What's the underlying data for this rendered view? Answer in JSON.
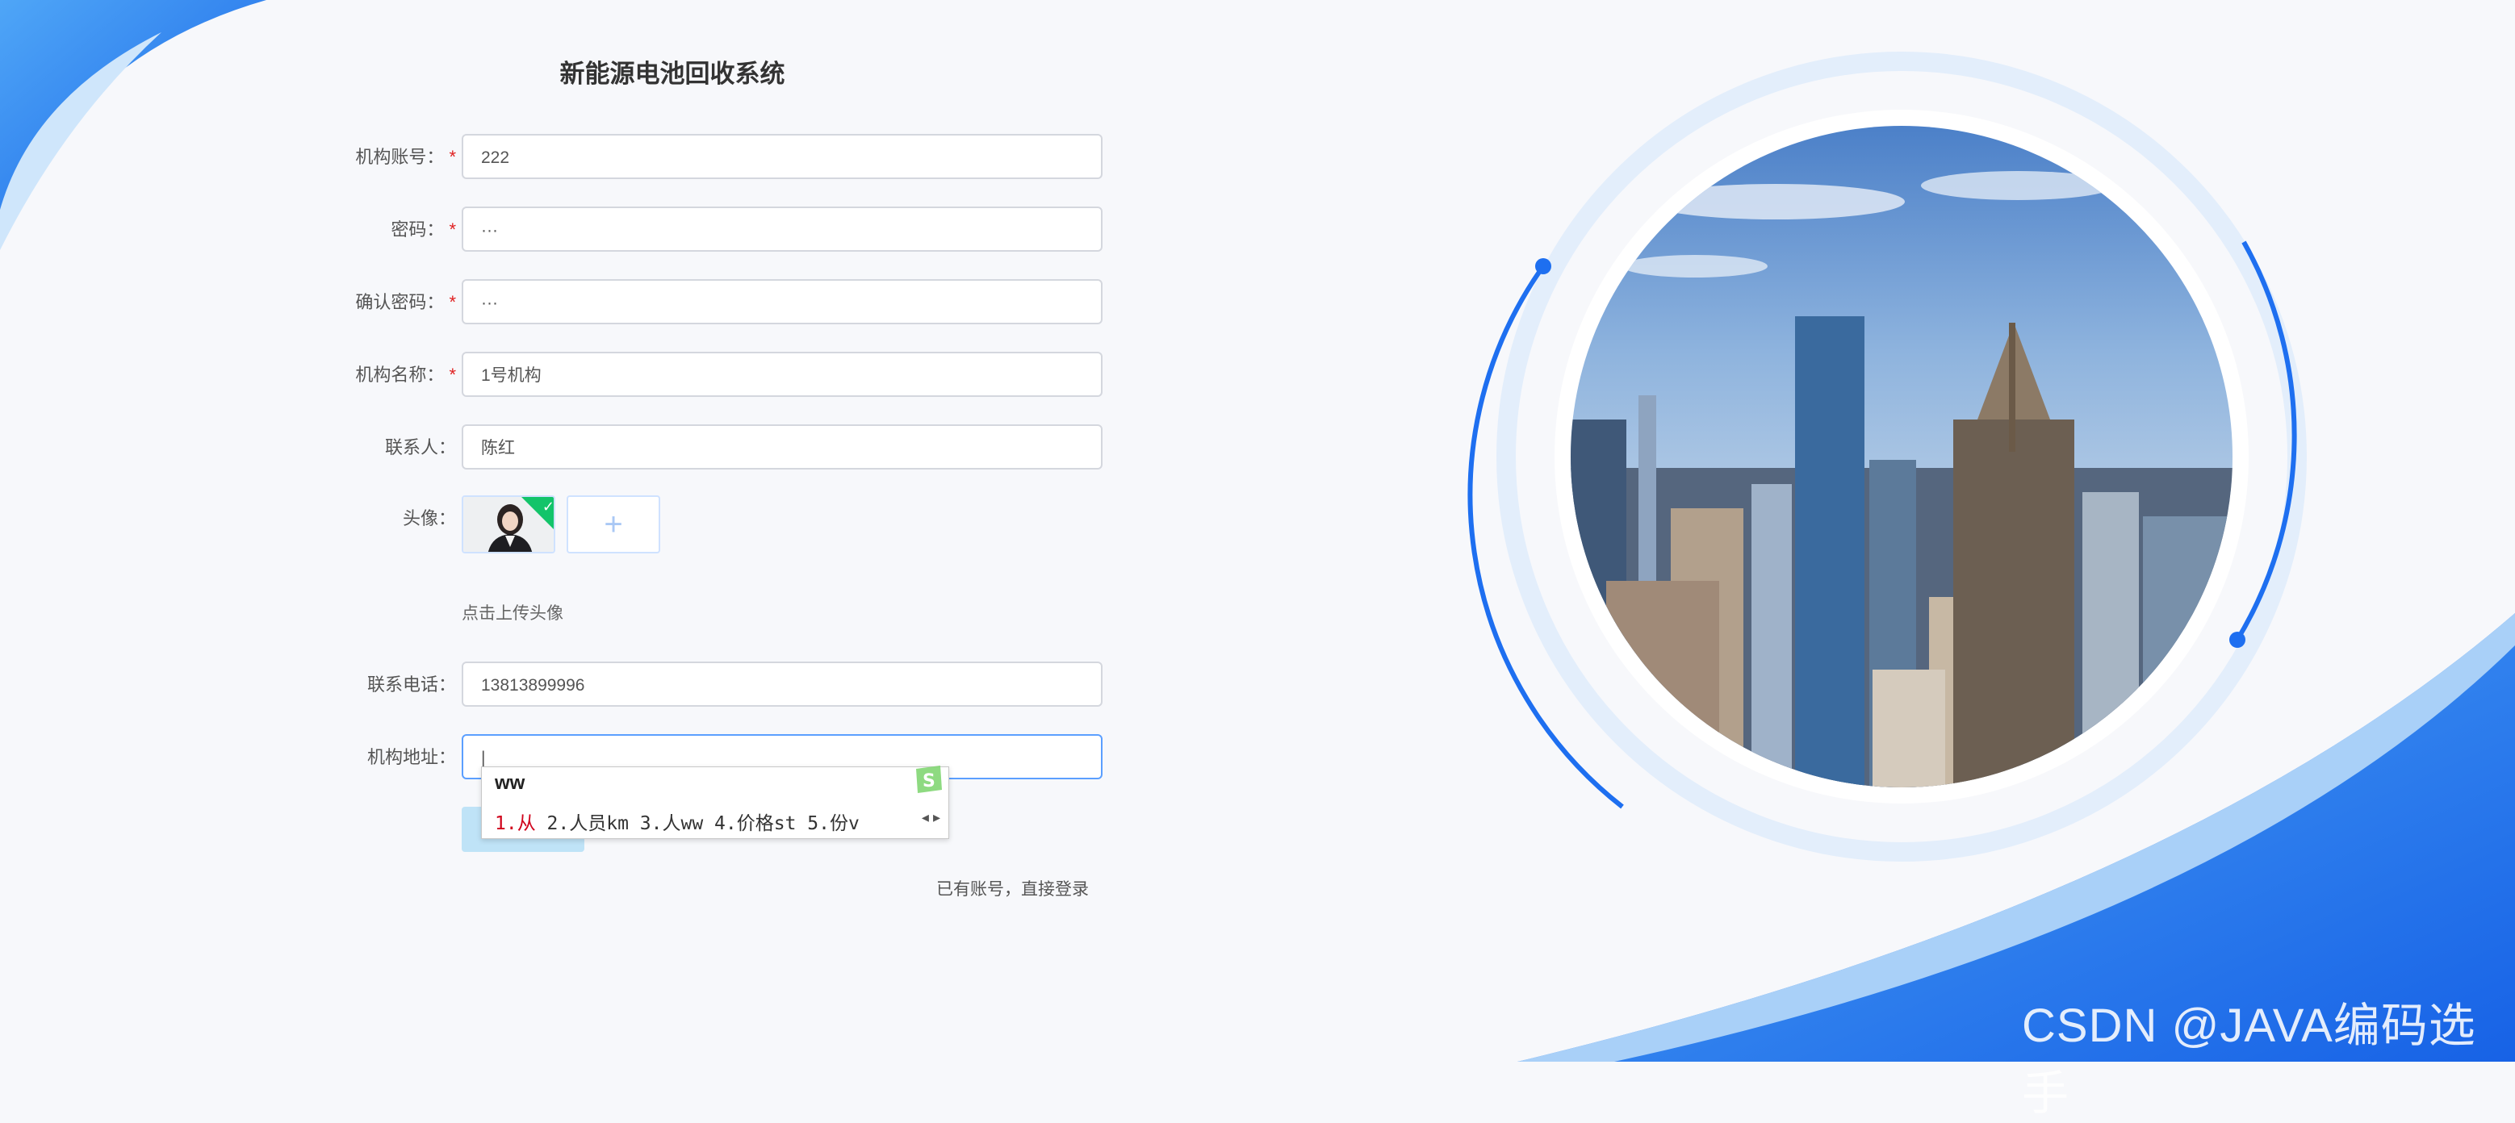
{
  "page": {
    "title": "新能源电池回收系统",
    "hint": "点击上传头像",
    "login_link": "已有账号，直接登录",
    "watermark": "CSDN @JAVA编码选手"
  },
  "form": {
    "account": {
      "label": "机构账号：",
      "required": "*",
      "value": "222"
    },
    "password": {
      "label": "密码：",
      "required": "*",
      "value": "···"
    },
    "confirm_password": {
      "label": "确认密码：",
      "required": "*",
      "value": "···"
    },
    "org_name": {
      "label": "机构名称：",
      "required": "*",
      "value": "1号机构"
    },
    "contact": {
      "label": "联系人：",
      "value": "陈红"
    },
    "avatar": {
      "label": "头像：",
      "plus": "+",
      "check": "✓"
    },
    "phone": {
      "label": "联系电话：",
      "value": "13813899996"
    },
    "address": {
      "label": "机构地址：",
      "value": "|"
    }
  },
  "ime": {
    "input": "ww",
    "candidate_1": "1.从",
    "candidates_rest": " 2.人员km 3.人ww 4.价格st 5.份v",
    "arrows": "◂ ▸"
  },
  "colors": {
    "brand_blue": "#1e6ff0",
    "required": "#e02020",
    "focus_border": "#5b9fff",
    "ime_highlight": "#d0021b"
  },
  "icons": {
    "avatar_check": "check-icon",
    "upload": "plus-icon",
    "ime_logo": "sogou-logo-icon"
  }
}
